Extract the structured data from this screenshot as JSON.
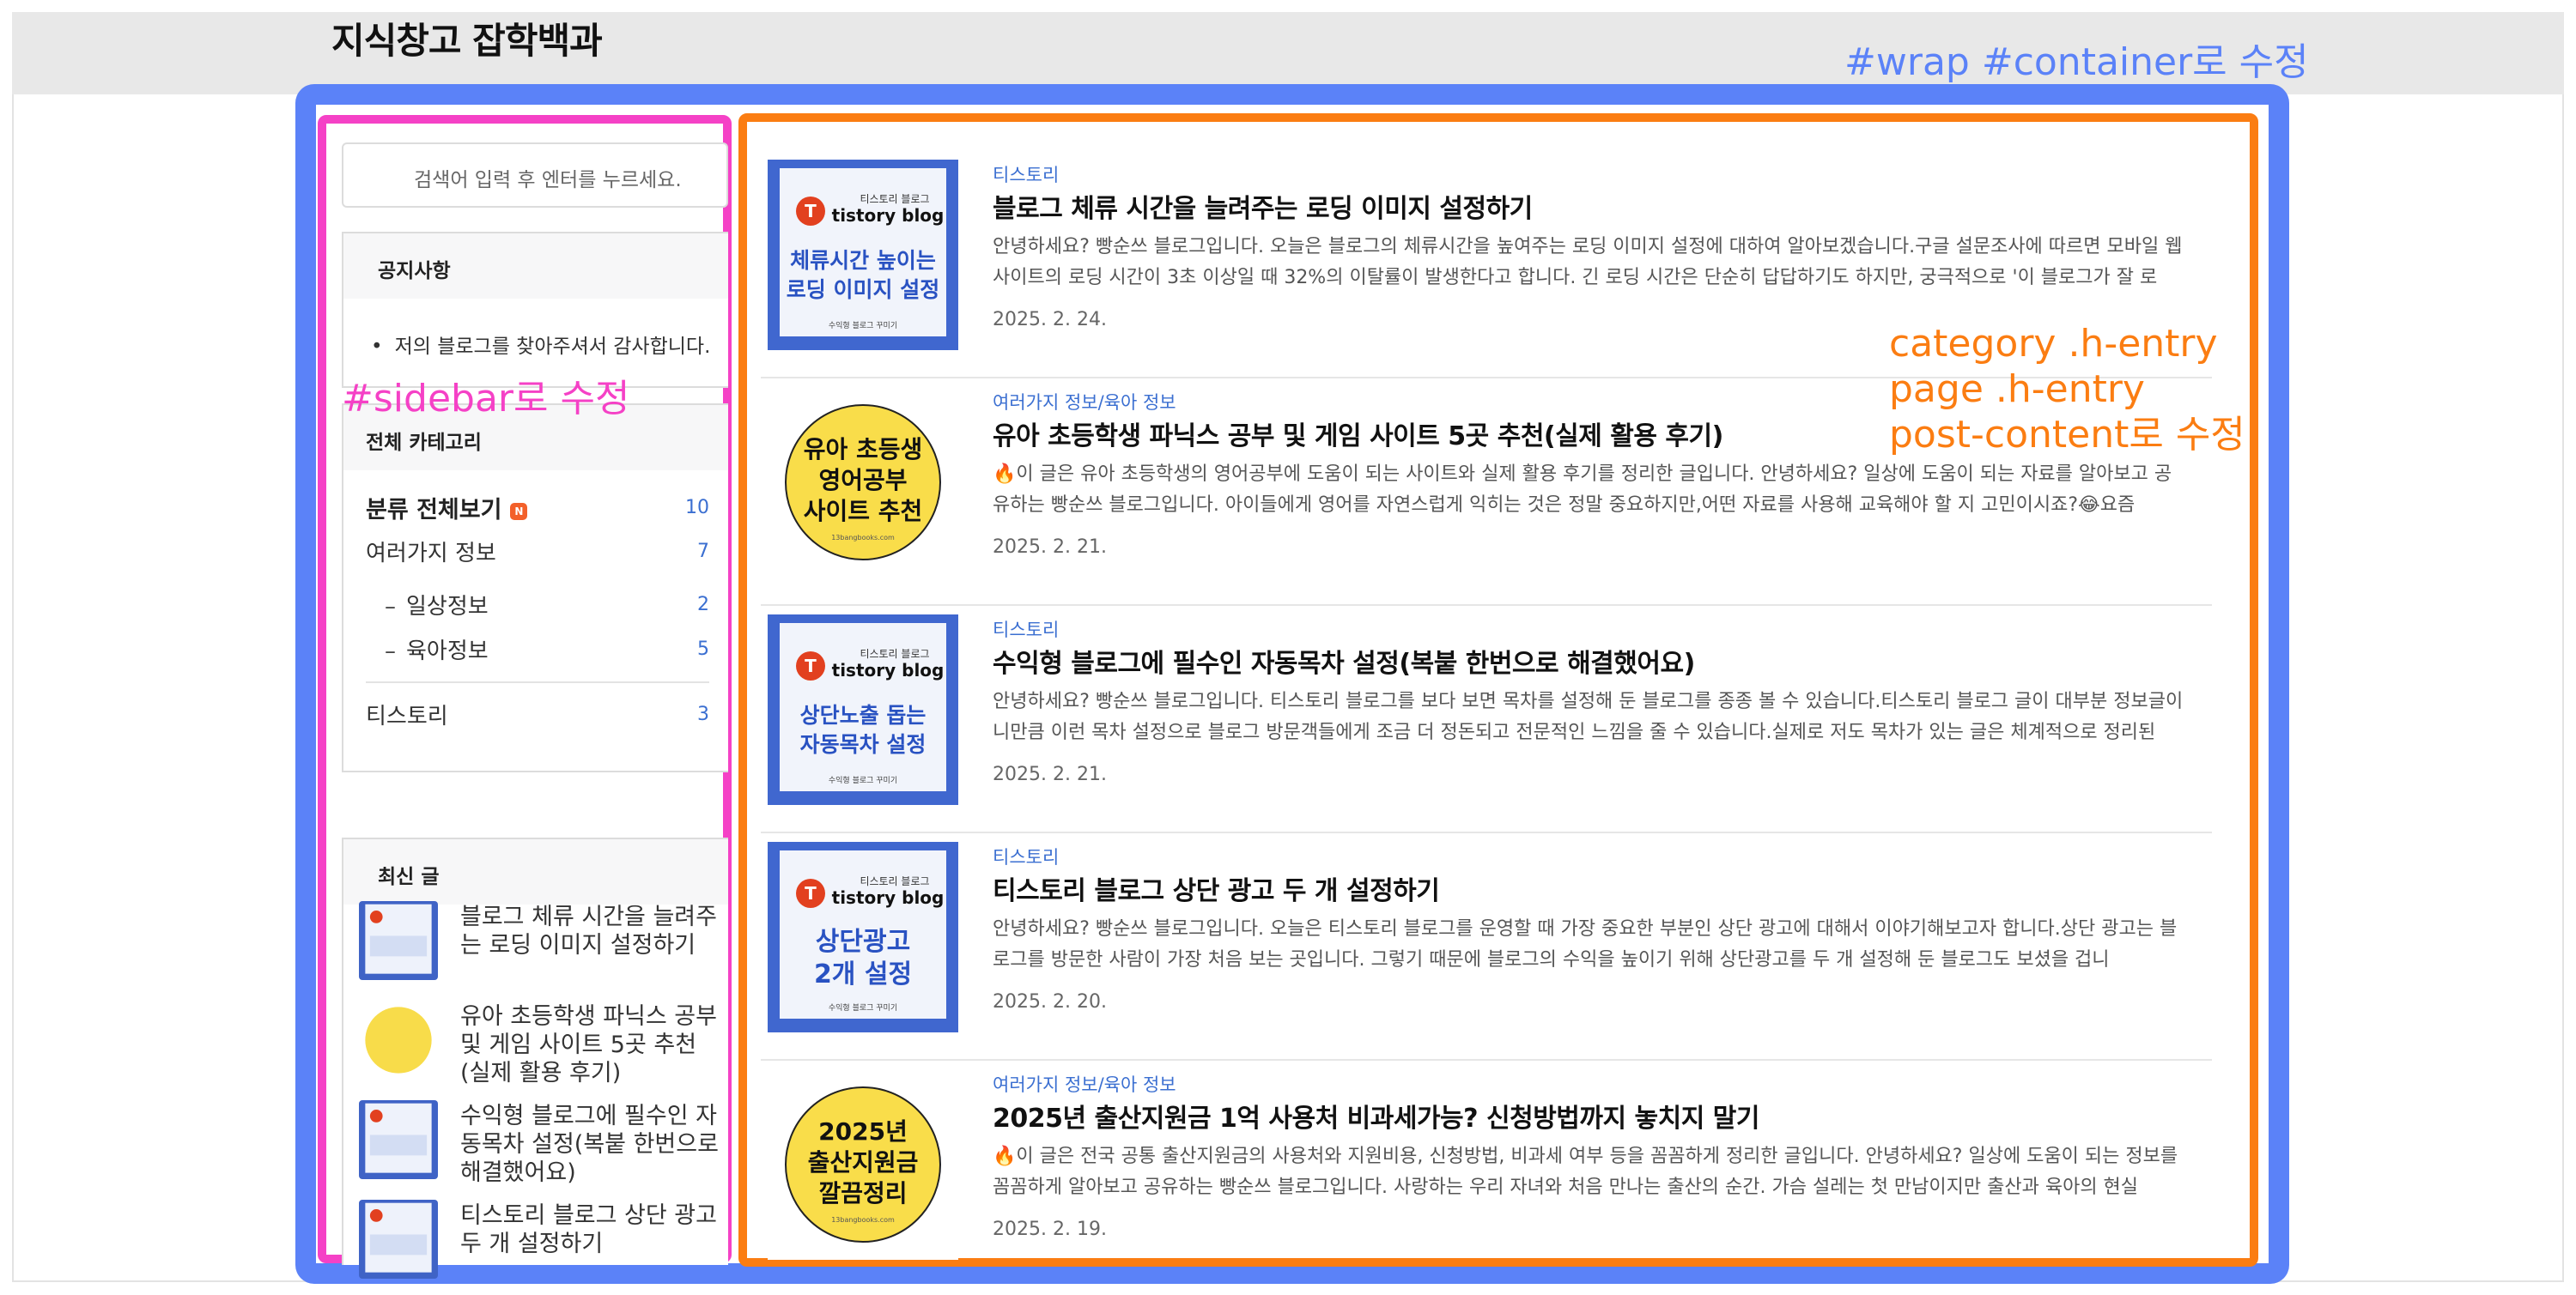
{
  "site": {
    "title": "지식창고 잡학백과"
  },
  "annotations": {
    "wrap": "#wrap #container로 수정",
    "sidebar": "#sidebar로 수정",
    "main": [
      "category .h-entry",
      "page .h-entry",
      "post-content로 수정"
    ]
  },
  "colors": {
    "wrap": "#5b82f8",
    "sidebar": "#f541c6",
    "main": "#fb7d12",
    "link": "#3b6fd1"
  },
  "sidebar": {
    "search_placeholder": "검색어 입력 후 엔터를 누르세요.",
    "notice": {
      "heading": "공지사항",
      "items": [
        "저의 블로그를 찾아주셔서 감사합니다."
      ]
    },
    "categories": {
      "heading": "전체 카테고리",
      "items": [
        {
          "name": "분류 전체보기",
          "count": "10",
          "badge": "N"
        },
        {
          "name": "여러가지 정보",
          "count": "7"
        },
        {
          "name": "일상정보",
          "count": "2"
        },
        {
          "name": "육아정보",
          "count": "5"
        },
        {
          "name": "티스토리",
          "count": "3"
        }
      ]
    },
    "recent": {
      "heading": "최신 글",
      "items": [
        {
          "title": "블로그 체류 시간을 늘려주는 로딩 이미지 설정하기"
        },
        {
          "title": "유아 초등학생 파닉스 공부 및 게임 사이트 5곳 추천(실제 활용 후기)"
        },
        {
          "title": "수익형 블로그에 필수인 자동목차 설정(복붙 한번으로 해결했어요)"
        },
        {
          "title": "티스토리 블로그 상단 광고 두 개 설정하기"
        }
      ]
    }
  },
  "thumb_text": {
    "brand_small": "티스토리 블로그",
    "brand_large": "tistory blog",
    "footer": "수익형 블로그 꾸미기",
    "footer_site": "13bangbooks.com",
    "t1": [
      "체류시간 높이는",
      "로딩 이미지 설정"
    ],
    "t2": [
      "유아 초등생",
      "영어공부",
      "사이트 추천"
    ],
    "t3": [
      "상단노출 돕는",
      "자동목차 설정"
    ],
    "t4": [
      "상단광고",
      "2개 설정"
    ],
    "t5": [
      "2025년",
      "출산지원금",
      "깔끔정리"
    ]
  },
  "posts": [
    {
      "category": "티스토리",
      "title": "블로그 체류 시간을 늘려주는 로딩 이미지 설정하기",
      "summary": "안녕하세요? 빵순쓰 블로그입니다. 오늘은 블로그의 체류시간을 높여주는 로딩 이미지 설정에 대하여 알아보겠습니다.구글 설문조사에 따르면 모바일 웹 사이트의 로딩 시간이 3초 이상일 때 32%의 이탈률이 발생한다고 합니다. 긴 로딩 시간은 단순히 답답하기도 하지만, 궁극적으로 '이 블로그가 잘 로",
      "date": "2025. 2. 24."
    },
    {
      "category": "여러가지 정보/육아 정보",
      "title": "유아 초등학생 파닉스 공부 및 게임 사이트 5곳 추천(실제 활용 후기)",
      "summary": "🔥이 글은 유아 초등학생의 영어공부에 도움이 되는 사이트와 실제 활용 후기를 정리한 글입니다.  안녕하세요? 일상에 도움이 되는 자료를 알아보고 공유하는 빵순쓰 블로그입니다. 아이들에게 영어를 자연스럽게 익히는 것은 정말 중요하지만,어떤 자료를 사용해 교육해야 할 지 고민이시죠?😂요즘",
      "date": "2025. 2. 21."
    },
    {
      "category": "티스토리",
      "title": "수익형 블로그에 필수인 자동목차 설정(복붙 한번으로 해결했어요)",
      "summary": "안녕하세요? 빵순쓰 블로그입니다. 티스토리 블로그를 보다 보면 목차를 설정해 둔 블로그를 종종 볼 수 있습니다.티스토리 블로그 글이 대부분 정보글이니만큼 이런 목차 설정으로 블로그 방문객들에게 조금 더 정돈되고 전문적인 느낌을 줄 수 있습니다.실제로 저도 목차가 있는 글은 체계적으로 정리된",
      "date": "2025. 2. 21."
    },
    {
      "category": "티스토리",
      "title": "티스토리 블로그 상단 광고 두 개 설정하기",
      "summary": "안녕하세요? 빵순쓰 블로그입니다. 오늘은 티스토리 블로그를 운영할 때 가장 중요한 부분인 상단 광고에 대해서 이야기해보고자 합니다.상단 광고는 블로그를 방문한 사람이 가장 처음 보는 곳입니다. 그렇기 때문에 블로그의 수익을 높이기 위해 상단광고를 두 개 설정해 둔 블로그도 보셨을 겁니",
      "date": "2025. 2. 20."
    },
    {
      "category": "여러가지 정보/육아 정보",
      "title": "2025년 출산지원금 1억 사용처 비과세가능? 신청방법까지 놓치지 말기",
      "summary": "🔥이 글은 전국 공통 출산지원금의 사용처와 지원비용, 신청방법, 비과세 여부 등을 꼼꼼하게 정리한 글입니다.  안녕하세요? 일상에 도움이 되는 정보를 꼼꼼하게 알아보고 공유하는 빵순쓰 블로그입니다. 사랑하는 우리 자녀와 처음 만나는 출산의 순간. 가슴 설레는 첫 만남이지만 출산과 육아의 현실",
      "date": "2025. 2. 19."
    }
  ]
}
